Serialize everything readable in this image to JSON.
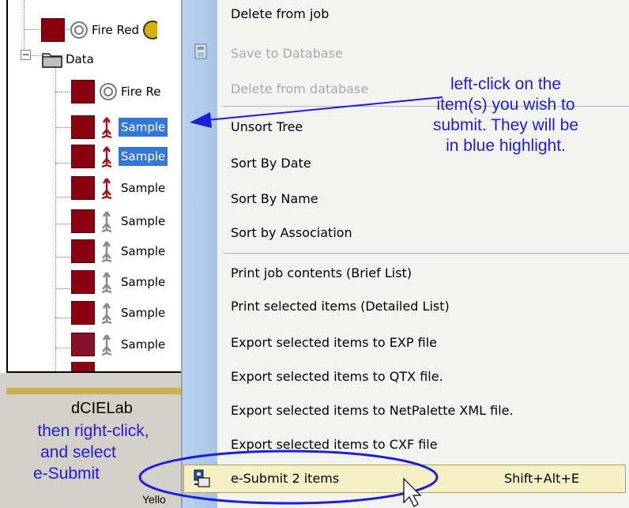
{
  "tree": {
    "rows": [
      {
        "label": "Fire Red",
        "color": "#8b0010",
        "icon": "target-icon"
      },
      {
        "label": "Data",
        "icon": "folder-icon",
        "expander": "−"
      },
      {
        "label": "Fire Re",
        "color": "#8b0010",
        "icon": "target-icon"
      },
      {
        "label": "Sample",
        "color": "#8b0010",
        "icon": "red-probe-icon",
        "selected": true
      },
      {
        "label": "Sample",
        "color": "#8b0010",
        "icon": "red-probe-icon",
        "selected": true
      },
      {
        "label": "Sample",
        "color": "#8b0010",
        "icon": "red-probe-icon"
      },
      {
        "label": "Sample",
        "color": "#8b0010",
        "icon": "gray-probe-icon"
      },
      {
        "label": "Sample",
        "color": "#8b0010",
        "icon": "gray-probe-icon"
      },
      {
        "label": "Sample",
        "color": "#8b0010",
        "icon": "gray-probe-icon"
      },
      {
        "label": "Sample",
        "color": "#8b0010",
        "icon": "gray-probe-icon"
      },
      {
        "label": "Sample",
        "color": "#86102a",
        "icon": "gray-probe-icon"
      }
    ]
  },
  "bottom_panel": {
    "label": "dCIELab",
    "partial_label": "Yello"
  },
  "menu": {
    "items": [
      {
        "label": "Delete from job",
        "disabled": false
      },
      {
        "label": "Save to Database",
        "disabled": true
      },
      {
        "label": "Delete from database",
        "disabled": true
      },
      {
        "label": "Unsort Tree",
        "disabled": false
      },
      {
        "label": "Sort By Date",
        "disabled": false
      },
      {
        "label": "Sort By Name",
        "disabled": false
      },
      {
        "label": "Sort by Association",
        "disabled": false
      },
      {
        "label": "Print job contents (Brief List)",
        "disabled": false
      },
      {
        "label": "Print selected items (Detailed List)",
        "disabled": false
      },
      {
        "label": "Export selected items to EXP file",
        "disabled": false
      },
      {
        "label": "Export selected items to QTX file.",
        "disabled": false
      },
      {
        "label": "Export selected items to NetPalette XML file.",
        "disabled": false
      },
      {
        "label": "Export selected items to CXF file",
        "disabled": false
      },
      {
        "label": "e-Submit 2 items",
        "shortcut": "Shift+Alt+E",
        "highlighted": true
      }
    ]
  },
  "annotations": {
    "right_note": [
      "left-click on the",
      "item(s) you wish to",
      "submit.  They will be",
      "in blue highlight."
    ],
    "left_note": [
      "then right-click,",
      "and select",
      "e-Submit"
    ]
  },
  "colors": {
    "selection": "#3476d9",
    "annotation": "#1d1ddb",
    "menu_highlight": "#f6f0c4",
    "gutter": "#bcd3ef"
  }
}
